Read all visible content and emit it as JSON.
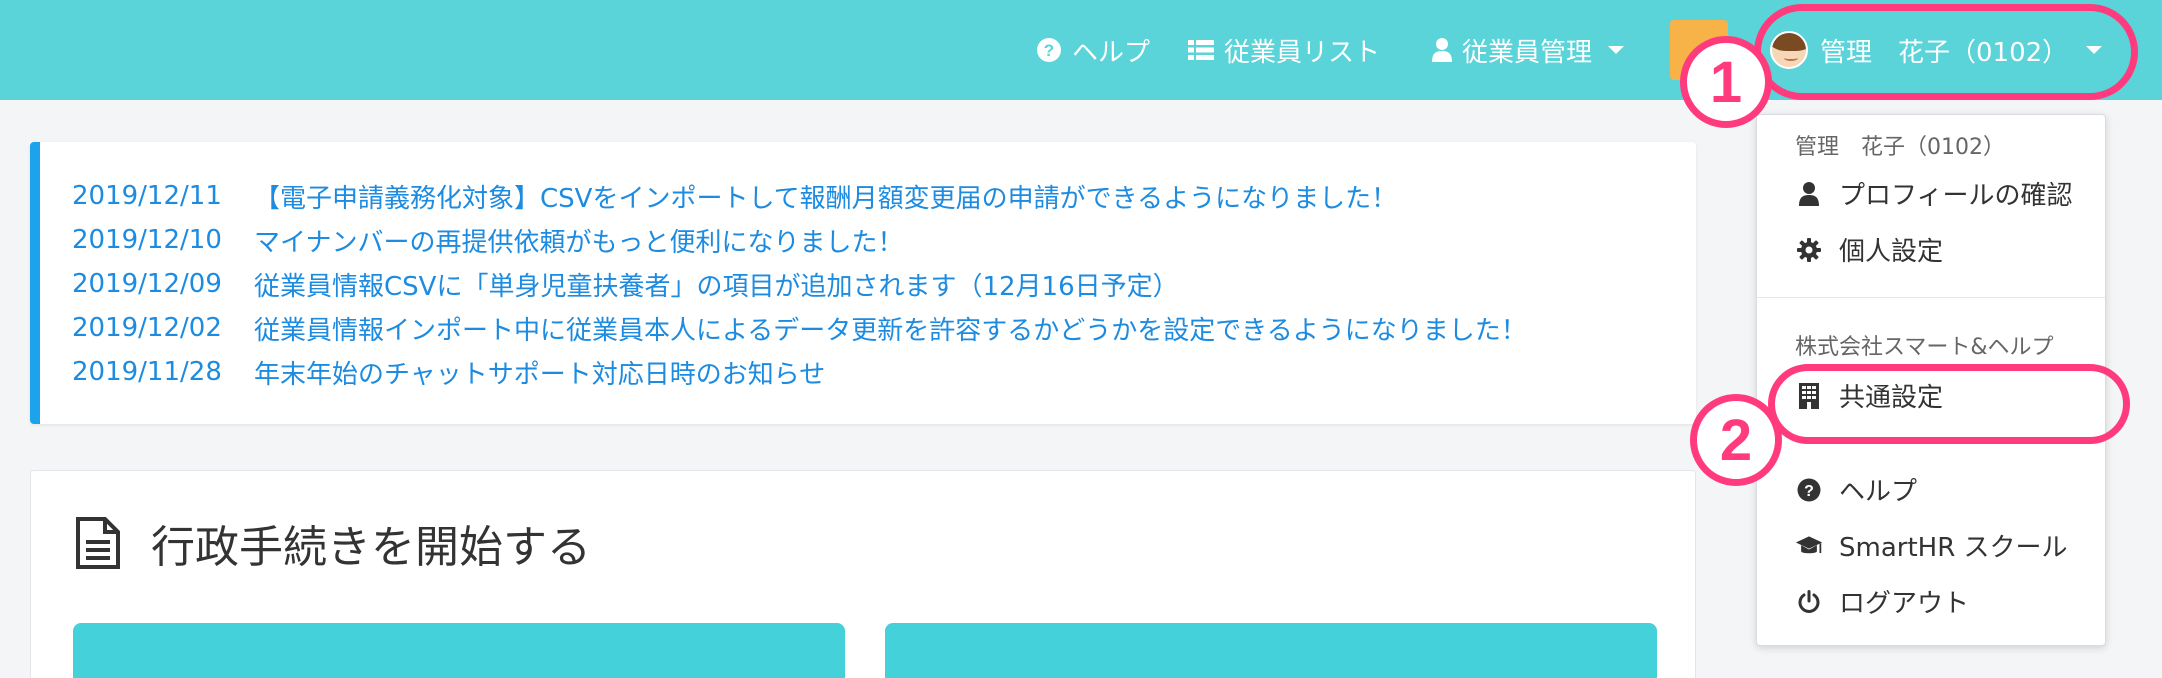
{
  "header": {
    "nav": [
      {
        "label": "ヘルプ",
        "icon": "question-circle-icon"
      },
      {
        "label": "従業員リスト",
        "icon": "list-icon"
      },
      {
        "label": "従業員管理",
        "icon": "user-icon"
      }
    ],
    "user": {
      "name": "管理　花子（0102）",
      "icon": "avatar"
    }
  },
  "notices": [
    {
      "date": "2019/12/11",
      "text": "【電子申請義務化対象】CSVをインポートして報酬月額変更届の申請ができるようになりました！"
    },
    {
      "date": "2019/12/10",
      "text": "マイナンバーの再提供依頼がもっと便利になりました！"
    },
    {
      "date": "2019/12/09",
      "text": "従業員情報CSVに「単身児童扶養者」の項目が追加されます（12月16日予定）"
    },
    {
      "date": "2019/12/02",
      "text": "従業員情報インポート中に従業員本人によるデータ更新を許容するかどうかを設定できるようになりました！"
    },
    {
      "date": "2019/11/28",
      "text": "年末年始のチャットサポート対応日時のお知らせ"
    }
  ],
  "procedures": {
    "title": "行政手続きを開始する",
    "icon": "document-icon"
  },
  "dropdown": {
    "user_header": "管理　花子（0102）",
    "profile": "プロフィールの確認",
    "personal_settings": "個人設定",
    "company_header": "株式会社スマート&ヘルプ",
    "common_settings": "共通設定",
    "help": "ヘルプ",
    "school": "SmartHR スクール",
    "logout": "ログアウト"
  },
  "annotations": {
    "badge1": "1",
    "badge2": "2"
  },
  "colors": {
    "header_bg": "#5ad3d9",
    "accent_pink": "#ff3b7d",
    "link_blue": "#1d8be0",
    "notice_border": "#1ca3ec",
    "tile": "#45d1d9",
    "user_square": "#f7b347"
  }
}
